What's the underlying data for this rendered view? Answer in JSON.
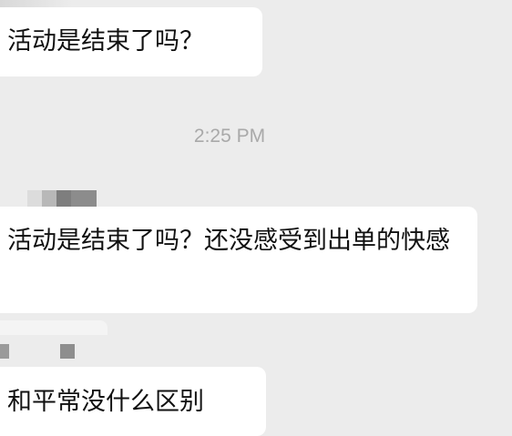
{
  "messages": [
    {
      "text": "活动是结束了吗？"
    },
    {
      "text": "活动是结束了吗？还没感受到出单的快感"
    },
    {
      "text": "和平常没什么区别"
    }
  ],
  "timestamp": "2:25 PM",
  "colors": {
    "background": "#ececec",
    "bubble": "#ffffff",
    "text": "#111111",
    "timestamp": "#a9a9a9"
  }
}
